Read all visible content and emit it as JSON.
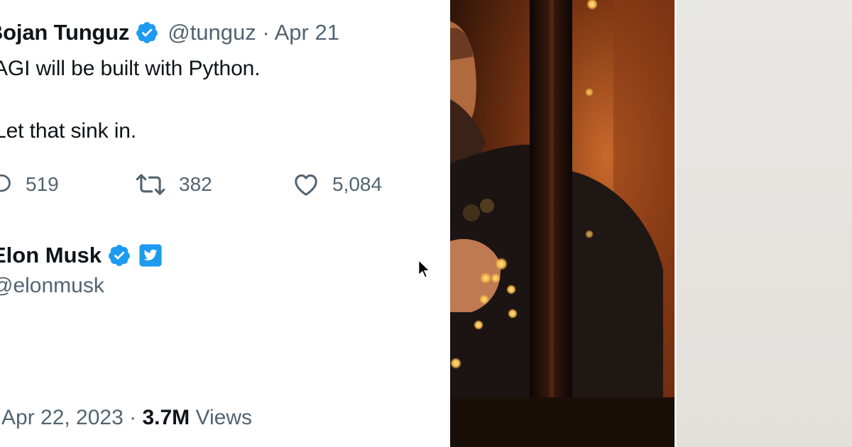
{
  "tweet": {
    "author_name": "Bojan Tunguz",
    "handle_date": "@tunguz · Apr 21",
    "text_line1": "AGI will be built with Python.",
    "text_line2": "Let that sink in.",
    "replies": "519",
    "retweets": "382",
    "likes": "5,084",
    "verified_color": "#1d9bf0"
  },
  "reply": {
    "author_name": "Elon Musk",
    "handle": "@elonmusk",
    "date": "Apr 22, 2023 · ",
    "views_count": "3.7M",
    "views_label": " Views",
    "badge_color": "#1d9bf0"
  },
  "icons": {
    "reply": "speech-bubble-icon",
    "retweet": "retweet-icon",
    "like": "heart-icon",
    "verified": "verified-badge-icon",
    "cursor": "mouse-pointer-icon"
  },
  "photo": {
    "subject": "man-in-dark-bar-photo",
    "palette": [
      "#2a1208",
      "#7a3412",
      "#c8692b",
      "#f2b34a"
    ]
  },
  "colors": {
    "text_primary": "#0f1419",
    "text_secondary": "#536471",
    "blank_panel": "#e7e4e0"
  }
}
